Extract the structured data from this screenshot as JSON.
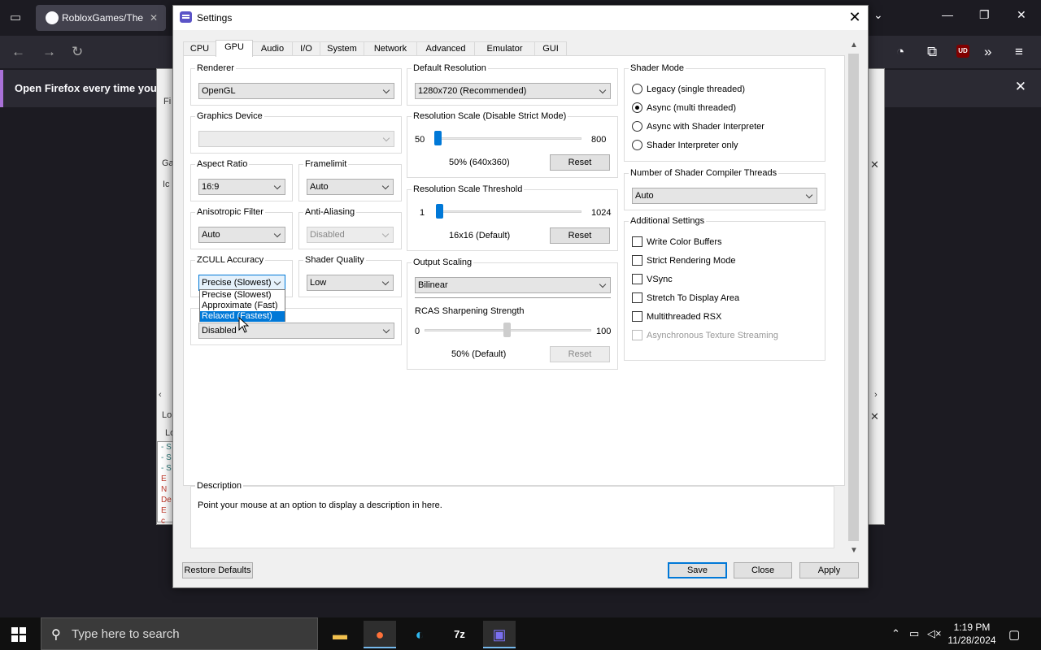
{
  "browser": {
    "tab_title": "RobloxGames/The",
    "tab_close": "✕",
    "notification": "Open Firefox every time you re",
    "notification_close": "✕",
    "ublock_label": "UD"
  },
  "rpcs3_main_peek": {
    "fi": "Fi",
    "ga": "Ga",
    "ic": "Ic",
    "lo": "Lo",
    "lo2": "Lo",
    "log_lines": [
      "- S",
      "- S",
      "- S",
      "E N",
      "De",
      "E c"
    ]
  },
  "dialog": {
    "title": "Settings",
    "tabs": [
      "CPU",
      "GPU",
      "Audio",
      "I/O",
      "System",
      "Network",
      "Advanced",
      "Emulator",
      "GUI"
    ],
    "active_tab": "GPU",
    "renderer": {
      "label": "Renderer",
      "value": "OpenGL"
    },
    "graphics_device": {
      "label": "Graphics Device",
      "value": ""
    },
    "aspect_ratio": {
      "label": "Aspect Ratio",
      "value": "16:9"
    },
    "framelimit": {
      "label": "Framelimit",
      "value": "Auto"
    },
    "anisotropic_filter": {
      "label": "Anisotropic Filter",
      "value": "Auto"
    },
    "anti_aliasing": {
      "label": "Anti-Aliasing",
      "value": "Disabled"
    },
    "zcull_accuracy": {
      "label": "ZCULL Accuracy",
      "value": "Precise (Slowest)",
      "options": [
        "Precise (Slowest)",
        "Approximate (Fast)",
        "Relaxed (Fastest)"
      ],
      "highlighted": "Relaxed (Fastest)"
    },
    "shader_quality": {
      "label": "Shader Quality",
      "value": "Low"
    },
    "hidden_combo": {
      "value": "Disabled"
    },
    "default_resolution": {
      "label": "Default Resolution",
      "value": "1280x720 (Recommended)"
    },
    "resolution_scale": {
      "label": "Resolution Scale (Disable Strict Mode)",
      "min": "50",
      "max": "800",
      "value_text": "50% (640x360)",
      "reset": "Reset"
    },
    "resolution_scale_threshold": {
      "label": "Resolution Scale Threshold",
      "min": "1",
      "max": "1024",
      "value_text": "16x16 (Default)",
      "reset": "Reset"
    },
    "output_scaling": {
      "label": "Output Scaling",
      "value": "Bilinear",
      "rcas_label": "RCAS Sharpening Strength",
      "rcas_min": "0",
      "rcas_max": "100",
      "rcas_value": "50% (Default)",
      "reset": "Reset"
    },
    "shader_mode": {
      "label": "Shader Mode",
      "options": [
        "Legacy (single threaded)",
        "Async (multi threaded)",
        "Async with Shader Interpreter",
        "Shader Interpreter only"
      ],
      "selected": "Async (multi threaded)"
    },
    "shader_compiler_threads": {
      "label": "Number of Shader Compiler Threads",
      "value": "Auto"
    },
    "additional_settings": {
      "label": "Additional Settings",
      "options": [
        "Write Color Buffers",
        "Strict Rendering Mode",
        "VSync",
        "Stretch To Display Area",
        "Multithreaded RSX",
        "Asynchronous Texture Streaming"
      ]
    },
    "description": {
      "label": "Description",
      "text": "Point your mouse at an option to display a description in here."
    },
    "buttons": {
      "restore": "Restore Defaults",
      "save": "Save",
      "close": "Close",
      "apply": "Apply"
    }
  },
  "taskbar": {
    "search_placeholder": "Type here to search",
    "time": "1:19 PM",
    "date": "11/28/2024"
  }
}
